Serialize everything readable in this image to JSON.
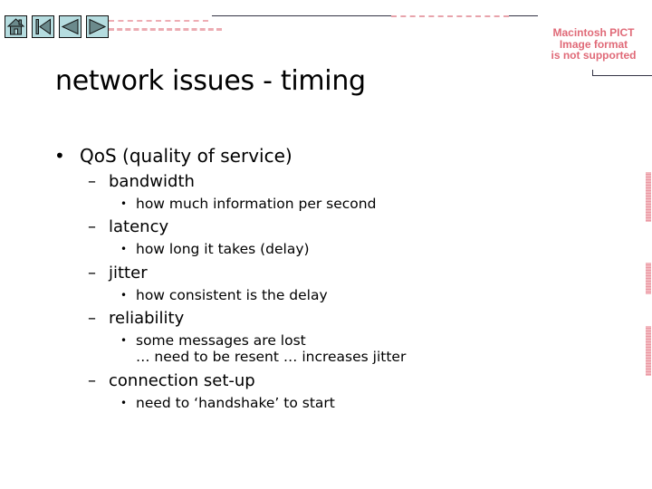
{
  "nav": {
    "buttons": [
      {
        "name": "home",
        "icon": "home-icon"
      },
      {
        "name": "first",
        "icon": "first-slide-icon"
      },
      {
        "name": "previous",
        "icon": "previous-icon"
      },
      {
        "name": "next",
        "icon": "next-icon"
      }
    ]
  },
  "placeholder_image": {
    "lines": [
      "Macintosh PICT",
      "Image format",
      "is not supported"
    ]
  },
  "colors": {
    "nav_button_fill": "#b5dcdf",
    "placeholder_text": "#e06a78"
  },
  "slide": {
    "title": "network issues - timing",
    "bullets": [
      {
        "text": "QoS (quality of service)",
        "children": [
          {
            "text": "bandwidth",
            "children": [
              {
                "lines": [
                  "how much information per second"
                ]
              }
            ]
          },
          {
            "text": "latency",
            "children": [
              {
                "lines": [
                  "how long it takes (delay)"
                ]
              }
            ]
          },
          {
            "text": "jitter",
            "children": [
              {
                "lines": [
                  "how consistent is the delay"
                ]
              }
            ]
          },
          {
            "text": "reliability",
            "children": [
              {
                "lines": [
                  "some messages are lost",
                  "… need to be resent … increases jitter"
                ]
              }
            ]
          },
          {
            "text": "connection set-up",
            "children": [
              {
                "lines": [
                  "need to ‘handshake’ to start"
                ]
              }
            ]
          }
        ]
      }
    ],
    "bullet_glyph": "•",
    "dash_glyph": "–"
  }
}
